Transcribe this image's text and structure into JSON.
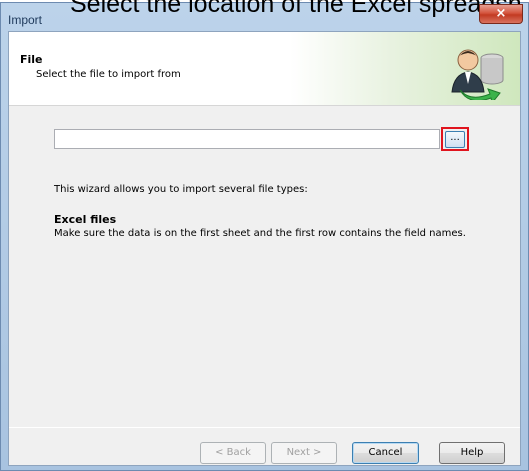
{
  "caption": "Select the location of the Excel spreadsh",
  "window": {
    "title": "Import",
    "close_glyph": "×"
  },
  "header": {
    "title": "File",
    "subtitle": "Select the file to import from",
    "icon": "user-database-arrow-icon"
  },
  "file_picker": {
    "value": "",
    "browse_label": "..."
  },
  "body": {
    "intro": "This wizard allows you to import several file types:",
    "section_title": "Excel files",
    "section_text": "Make sure the data is on the first sheet and the first row contains the field names."
  },
  "buttons": {
    "back": "< Back",
    "next": "Next >",
    "cancel": "Cancel",
    "help": "Help"
  },
  "colors": {
    "highlight": "#e0141e",
    "close_button": "#c23a22",
    "header_green": "#cfe7bd"
  }
}
